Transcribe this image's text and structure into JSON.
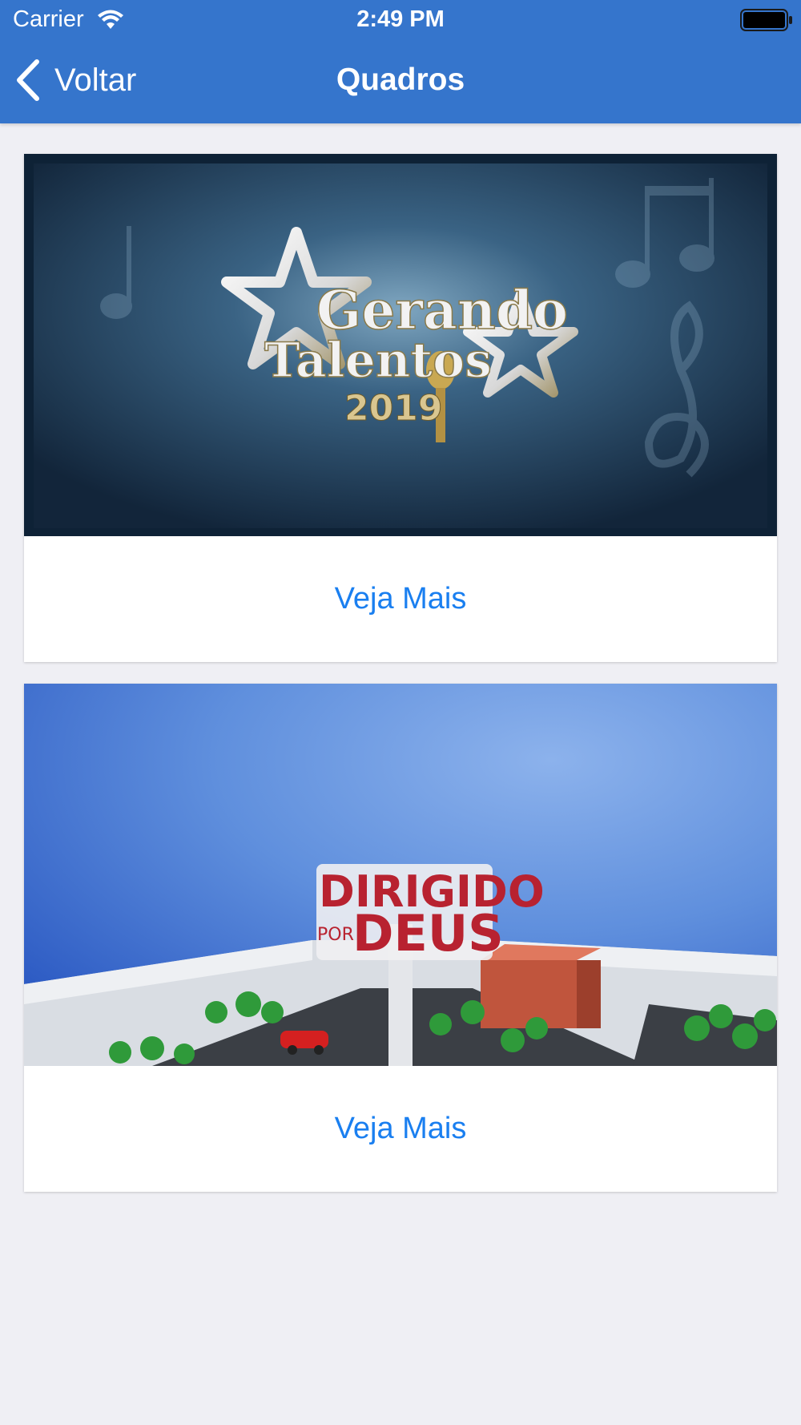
{
  "status_bar": {
    "carrier": "Carrier",
    "time": "2:49 PM"
  },
  "nav": {
    "back_label": "Voltar",
    "title": "Quadros"
  },
  "colors": {
    "nav_background": "#3575cc",
    "page_background": "#efeff4",
    "link": "#1a7ff0"
  },
  "cards": [
    {
      "image_logo_lines": [
        "Gerando",
        "Talentos",
        "2019"
      ],
      "action_label": "Veja Mais"
    },
    {
      "image_logo_lines": [
        "DIRIGIDO",
        "POR",
        "DEUS"
      ],
      "action_label": "Veja Mais"
    }
  ]
}
